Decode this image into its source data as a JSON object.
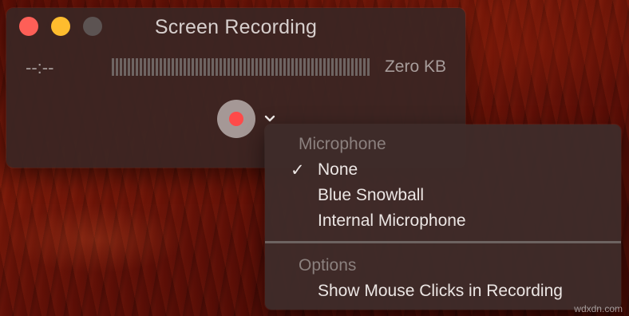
{
  "window": {
    "title": "Screen Recording",
    "timer": "--:--",
    "file_size": "Zero KB"
  },
  "menu": {
    "microphone_header": "Microphone",
    "microphone_items": [
      {
        "label": "None",
        "checked": true
      },
      {
        "label": "Blue Snowball",
        "checked": false
      },
      {
        "label": "Internal Microphone",
        "checked": false
      }
    ],
    "checkmark": "✓",
    "options_header": "Options",
    "options_items": [
      {
        "label": "Show Mouse Clicks in Recording"
      }
    ]
  },
  "watermark": "wdxdn.com",
  "colors": {
    "close": "#fe5f57",
    "minimize": "#febc2e",
    "record_dot": "#fe4a49"
  },
  "icons": {
    "record": "record-icon",
    "options_chevron": "chevron-down-icon"
  }
}
